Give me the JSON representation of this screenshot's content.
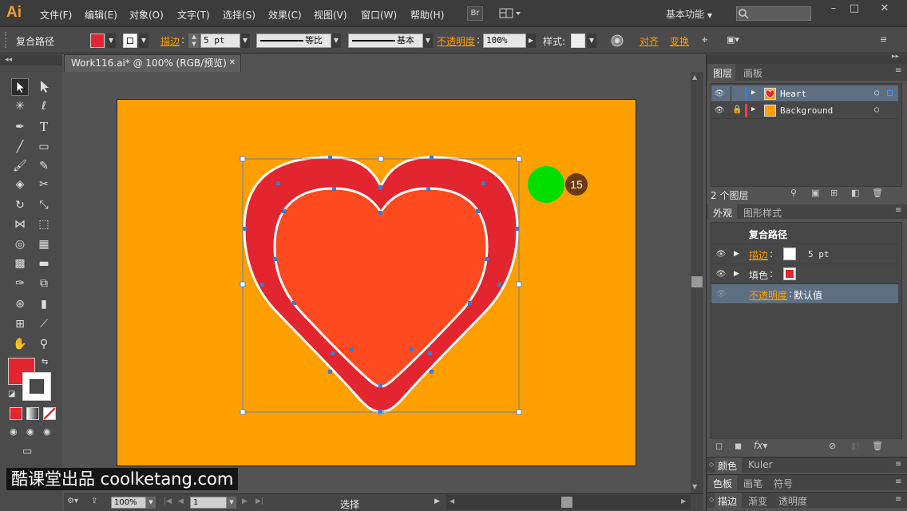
{
  "menubar": {
    "logo": "Ai",
    "items": [
      "文件(F)",
      "编辑(E)",
      "对象(O)",
      "文字(T)",
      "选择(S)",
      "效果(C)",
      "视图(V)",
      "窗口(W)",
      "帮助(H)"
    ],
    "bridge_label": "Br",
    "workspace": "基本功能"
  },
  "controlbar": {
    "object_type": "复合路径",
    "stroke_label": "描边",
    "stroke_weight": "5 pt",
    "profile_label": "等比",
    "brush_label": "基本",
    "opacity_label": "不透明度",
    "opacity_value": "100%",
    "style_label": "样式",
    "align_label": "对齐",
    "transform_label": "变换",
    "fill_color": "#e32530"
  },
  "document": {
    "tab_title": "Work116.ai* @ 100% (RGB/预览)",
    "artboard_color": "#ffa000",
    "heart_outer_color": "#e32530",
    "heart_inner_color": "#ff4a20",
    "step_badge": "15",
    "step_dot_color": "#00dd00"
  },
  "statusbar": {
    "zoom": "100%",
    "artboard_number": "1",
    "current_tool": "选择"
  },
  "layers_panel": {
    "tabs": [
      "图层",
      "画板"
    ],
    "layers": [
      {
        "name": "Heart",
        "color": "#3a7bd5",
        "selected": true
      },
      {
        "name": "Background",
        "color": "#ff4040",
        "locked": true
      }
    ],
    "footer": "2 个图层"
  },
  "appearance_panel": {
    "tabs": [
      "外观",
      "图形样式"
    ],
    "header": "复合路径",
    "rows": [
      {
        "label": "描边",
        "value": "5 pt",
        "swatch": "#ffffff"
      },
      {
        "label": "填色",
        "value": "",
        "swatch": "#e32530"
      },
      {
        "label": "不透明度",
        "value": "默认值"
      }
    ],
    "footer_fx": "fx"
  },
  "collapsed_panels": [
    [
      "颜色",
      "Kuler"
    ],
    [
      "色板",
      "画笔",
      "符号"
    ],
    [
      "描边",
      "渐变",
      "透明度"
    ]
  ],
  "watermark": "酷课堂出品 coolketang.com"
}
